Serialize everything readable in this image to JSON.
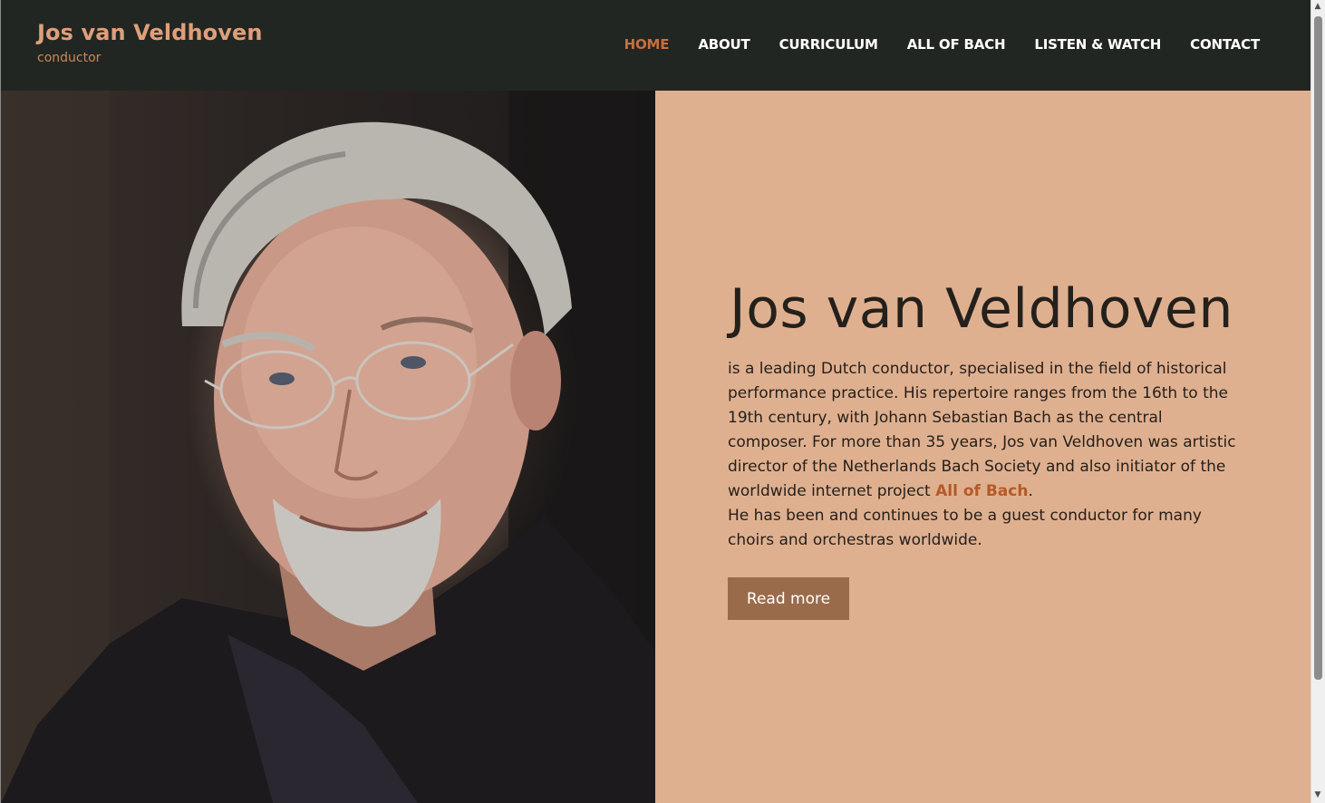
{
  "site": {
    "name": "Jos van Veldhoven",
    "tagline": "conductor"
  },
  "nav": {
    "items": [
      {
        "label": "HOME",
        "active": true
      },
      {
        "label": "ABOUT",
        "active": false
      },
      {
        "label": "CURRICULUM",
        "active": false
      },
      {
        "label": "ALL OF BACH",
        "active": false
      },
      {
        "label": "LISTEN & WATCH",
        "active": false
      },
      {
        "label": "CONTACT",
        "active": false
      }
    ]
  },
  "hero": {
    "title": "Jos van Veldhoven",
    "intro_before_link": "is a leading Dutch conductor, specialised in the field of historical performance practice. His repertoire ranges from the 16th to the 19th century, with Johann Sebastian Bach as the central composer. For more than 35 years, Jos van Veldhoven was artistic director of the Netherlands Bach Society and also initiator of the worldwide internet project ",
    "intro_link": "All of Bach",
    "intro_after_link": ".",
    "second_paragraph": "He has been and continues to be a guest conductor for many choirs and orchestras worldwide.",
    "button_label": "Read more",
    "photo_alt": "portrait-photo"
  },
  "colors": {
    "header_bg": "#222623",
    "brand": "#df9f7a",
    "nav_active": "#c7703f",
    "panel_bg": "#dfb08f",
    "button_bg": "#9a6b4b",
    "link": "#b55a28"
  },
  "scrollbar": {
    "up_icon": "scroll-up-arrow-icon",
    "down_icon": "scroll-down-arrow-icon"
  }
}
